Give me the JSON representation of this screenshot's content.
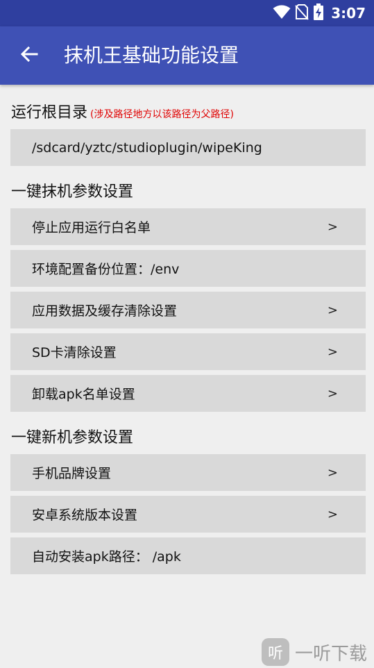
{
  "status_bar": {
    "time": "3:07",
    "icons": [
      "wifi-icon",
      "no-sim-icon",
      "battery-charging-icon"
    ]
  },
  "app_bar": {
    "title": "抹机王基础功能设置",
    "back_icon": "arrow-left-icon"
  },
  "root_dir": {
    "title": "运行根目录",
    "note": "(涉及路径地方以该路径为父路径)",
    "path": "/sdcard/yztc/studioplugin/wipeKing"
  },
  "wipe_section": {
    "title": "一键抹机参数设置",
    "items": [
      {
        "label": "停止应用运行白名单",
        "arrow": ">"
      },
      {
        "label": "环境配置备份位置：/env",
        "arrow": ""
      },
      {
        "label": "应用数据及缓存清除设置",
        "arrow": ">"
      },
      {
        "label": "SD卡清除设置",
        "arrow": ">"
      },
      {
        "label": "卸载apk名单设置",
        "arrow": ">"
      }
    ]
  },
  "new_section": {
    "title": "一键新机参数设置",
    "items": [
      {
        "label": "手机品牌设置",
        "arrow": ">"
      },
      {
        "label": "安卓系统版本设置",
        "arrow": ">"
      },
      {
        "label": "自动安装apk路径： /apk",
        "arrow": ""
      }
    ]
  },
  "watermark": {
    "logo": "听",
    "text": "一听下载"
  },
  "colors": {
    "app_bar": "#3f51b5",
    "status_bar": "#2f3f9f",
    "background": "#efefef",
    "row": "#d9d9d9",
    "note": "#e00000"
  }
}
